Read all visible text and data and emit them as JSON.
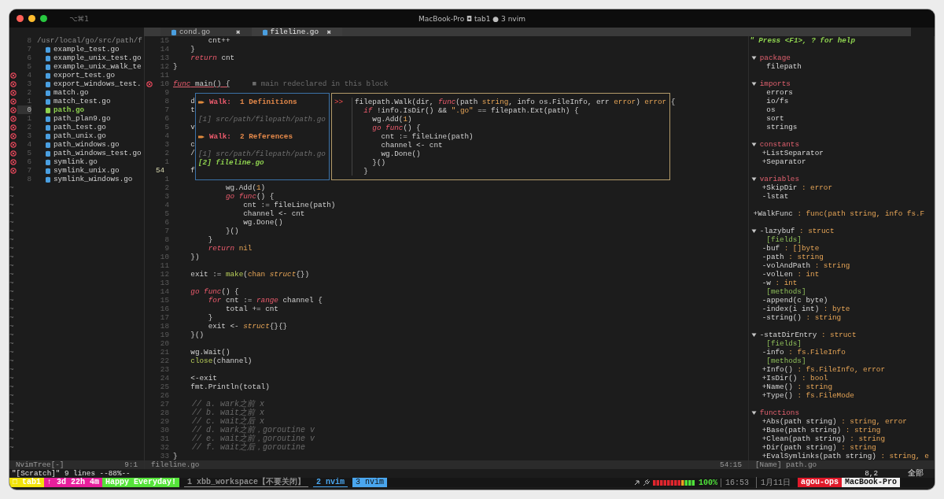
{
  "window": {
    "shortcut": "⌥⌘1",
    "title": "MacBook-Pro ◘ tab1 ● 3 nvim"
  },
  "tabs": [
    {
      "label": "cond.go",
      "close": "✖",
      "selected": false
    },
    {
      "label": "fileline.go",
      "close": "✖",
      "selected": true
    }
  ],
  "tree": {
    "root": {
      "num": "8",
      "path": "/usr/local/go/src/path/f"
    },
    "files": [
      {
        "num": "7",
        "name": "example_test.go",
        "error": false,
        "selected": false
      },
      {
        "num": "6",
        "name": "example_unix_test.go",
        "error": false,
        "selected": false
      },
      {
        "num": "5",
        "name": "example_unix_walk_te",
        "error": false,
        "selected": false
      },
      {
        "num": "4",
        "name": "export_test.go",
        "error": true,
        "selected": false
      },
      {
        "num": "3",
        "name": "export_windows_test.",
        "error": true,
        "selected": false
      },
      {
        "num": "2",
        "name": "match.go",
        "error": true,
        "selected": false
      },
      {
        "num": "1",
        "name": "match_test.go",
        "error": true,
        "selected": false
      },
      {
        "num": "0",
        "name": "path.go",
        "error": true,
        "selected": true
      },
      {
        "num": "1",
        "name": "path_plan9.go",
        "error": true,
        "selected": false
      },
      {
        "num": "2",
        "name": "path_test.go",
        "error": true,
        "selected": false
      },
      {
        "num": "3",
        "name": "path_unix.go",
        "error": true,
        "selected": false
      },
      {
        "num": "4",
        "name": "path_windows.go",
        "error": true,
        "selected": false
      },
      {
        "num": "5",
        "name": "path_windows_test.go",
        "error": true,
        "selected": false
      },
      {
        "num": "6",
        "name": "symlink.go",
        "error": true,
        "selected": false
      },
      {
        "num": "7",
        "name": "symlink_unix.go",
        "error": true,
        "selected": false
      },
      {
        "num": "8",
        "name": "symlink_windows.go",
        "error": false,
        "selected": false
      }
    ],
    "filler": [
      "~",
      "~",
      "~",
      "~",
      "~",
      "~",
      "~",
      "~",
      "~",
      "~",
      "~",
      "~",
      "~",
      "~",
      "~",
      "~",
      "~",
      "~",
      "~",
      "~",
      "~",
      "~",
      "~",
      "~",
      "~",
      "~",
      "~",
      "~",
      "~",
      "~",
      "~"
    ],
    "status": {
      "name": "NvimTree[-]",
      "position": "9:1"
    }
  },
  "editor": {
    "lines": [
      {
        "num": "15",
        "current": false,
        "error": false,
        "tokens": [
          {
            "text": "        cnt++",
            "kind": "plain"
          }
        ]
      },
      {
        "num": "14",
        "current": false,
        "error": false,
        "tokens": [
          {
            "text": "    }",
            "kind": "plain"
          }
        ]
      },
      {
        "num": "13",
        "current": false,
        "error": false,
        "tokens": [
          {
            "text": "    return",
            "kind": "keyword"
          },
          {
            "text": " cnt",
            "kind": "plain"
          }
        ]
      },
      {
        "num": "12",
        "current": false,
        "error": false,
        "tokens": [
          {
            "text": "}",
            "kind": "plain"
          }
        ]
      },
      {
        "num": "11",
        "current": false,
        "error": false
      },
      {
        "num": "10",
        "current": false,
        "error": true,
        "tokens": [
          {
            "text": "func",
            "kind": "errkeyword"
          },
          {
            "text": " main() {",
            "kind": "errplain"
          }
        ],
        "diagnostic": "■ main redeclared in this block"
      },
      {
        "num": "9",
        "current": false,
        "error": false
      },
      {
        "num": "8",
        "current": false,
        "error": false,
        "tokens": [
          {
            "text": "    d",
            "kind": "plain"
          }
        ]
      },
      {
        "num": "7",
        "current": false,
        "error": false,
        "tokens": [
          {
            "text": "    t",
            "kind": "plain"
          }
        ]
      },
      {
        "num": "6",
        "current": false,
        "error": false
      },
      {
        "num": "5",
        "current": false,
        "error": false,
        "tokens": [
          {
            "text": "    v",
            "kind": "plain"
          }
        ]
      },
      {
        "num": "4",
        "current": false,
        "error": false
      },
      {
        "num": "3",
        "current": false,
        "error": false,
        "tokens": [
          {
            "text": "    c",
            "kind": "plain"
          }
        ]
      },
      {
        "num": "2",
        "current": false,
        "error": false,
        "tokens": [
          {
            "text": "    /",
            "kind": "plain"
          }
        ]
      },
      {
        "num": "1",
        "current": false,
        "error": false
      },
      {
        "num": "54",
        "current": true,
        "error": false,
        "tokens": [
          {
            "text": "    f",
            "kind": "plain"
          }
        ]
      },
      {
        "num": "1",
        "current": false,
        "error": false
      },
      {
        "num": "2",
        "current": false,
        "error": false,
        "tokens": [
          {
            "text": "            wg.Add(",
            "kind": "plain"
          },
          {
            "text": "1",
            "kind": "number"
          },
          {
            "text": ")",
            "kind": "plain"
          }
        ]
      },
      {
        "num": "3",
        "current": false,
        "error": false,
        "tokens": [
          {
            "text": "            go func",
            "kind": "keyword"
          },
          {
            "text": "() {",
            "kind": "plain"
          }
        ]
      },
      {
        "num": "4",
        "current": false,
        "error": false,
        "tokens": [
          {
            "text": "                cnt := fileLine(path)",
            "kind": "plain"
          }
        ]
      },
      {
        "num": "5",
        "current": false,
        "error": false,
        "tokens": [
          {
            "text": "                channel <- cnt",
            "kind": "plain"
          }
        ]
      },
      {
        "num": "6",
        "current": false,
        "error": false,
        "tokens": [
          {
            "text": "                wg.Done()",
            "kind": "plain"
          }
        ]
      },
      {
        "num": "7",
        "current": false,
        "error": false,
        "tokens": [
          {
            "text": "            }()",
            "kind": "plain"
          }
        ]
      },
      {
        "num": "8",
        "current": false,
        "error": false,
        "tokens": [
          {
            "text": "        }",
            "kind": "plain"
          }
        ]
      },
      {
        "num": "9",
        "current": false,
        "error": false,
        "tokens": [
          {
            "text": "        return",
            "kind": "keyword"
          },
          {
            "text": " nil",
            "kind": "number"
          }
        ]
      },
      {
        "num": "10",
        "current": false,
        "error": false,
        "tokens": [
          {
            "text": "    })",
            "kind": "plain"
          }
        ]
      },
      {
        "num": "11",
        "current": false,
        "error": false
      },
      {
        "num": "12",
        "current": false,
        "error": false,
        "tokens": [
          {
            "text": "    exit := ",
            "kind": "plain"
          },
          {
            "text": "make",
            "kind": "builtin"
          },
          {
            "text": "(",
            "kind": "plain"
          },
          {
            "text": "chan",
            "kind": "number"
          },
          {
            "text": " struct",
            "kind": "type"
          },
          {
            "text": "{})",
            "kind": "plain"
          }
        ]
      },
      {
        "num": "13",
        "current": false,
        "error": false
      },
      {
        "num": "14",
        "current": false,
        "error": false,
        "tokens": [
          {
            "text": "    go func",
            "kind": "keyword"
          },
          {
            "text": "() {",
            "kind": "plain"
          }
        ]
      },
      {
        "num": "15",
        "current": false,
        "error": false,
        "tokens": [
          {
            "text": "        for",
            "kind": "keyword"
          },
          {
            "text": " cnt := ",
            "kind": "plain"
          },
          {
            "text": "range",
            "kind": "keyword"
          },
          {
            "text": " channel {",
            "kind": "plain"
          }
        ]
      },
      {
        "num": "16",
        "current": false,
        "error": false,
        "tokens": [
          {
            "text": "            total += cnt",
            "kind": "plain"
          }
        ]
      },
      {
        "num": "17",
        "current": false,
        "error": false,
        "tokens": [
          {
            "text": "        }",
            "kind": "plain"
          }
        ]
      },
      {
        "num": "18",
        "current": false,
        "error": false,
        "tokens": [
          {
            "text": "        exit <- ",
            "kind": "plain"
          },
          {
            "text": "struct",
            "kind": "type"
          },
          {
            "text": "{}{}",
            "kind": "plain"
          }
        ]
      },
      {
        "num": "19",
        "current": false,
        "error": false,
        "tokens": [
          {
            "text": "    }()",
            "kind": "plain"
          }
        ]
      },
      {
        "num": "20",
        "current": false,
        "error": false
      },
      {
        "num": "21",
        "current": false,
        "error": false,
        "tokens": [
          {
            "text": "    wg.Wait()",
            "kind": "plain"
          }
        ]
      },
      {
        "num": "22",
        "current": false,
        "error": false,
        "tokens": [
          {
            "text": "    close",
            "kind": "builtin"
          },
          {
            "text": "(channel)",
            "kind": "plain"
          }
        ]
      },
      {
        "num": "23",
        "current": false,
        "error": false
      },
      {
        "num": "24",
        "current": false,
        "error": false,
        "tokens": [
          {
            "text": "    <-exit",
            "kind": "plain"
          }
        ]
      },
      {
        "num": "25",
        "current": false,
        "error": false,
        "tokens": [
          {
            "text": "    fmt.Println(total)",
            "kind": "plain"
          }
        ]
      },
      {
        "num": "26",
        "current": false,
        "error": false
      },
      {
        "num": "27",
        "current": false,
        "error": false,
        "tokens": [
          {
            "text": "    // a. wark之前 x",
            "kind": "comment"
          }
        ]
      },
      {
        "num": "28",
        "current": false,
        "error": false,
        "tokens": [
          {
            "text": "    // b. wait之前 x",
            "kind": "comment"
          }
        ]
      },
      {
        "num": "29",
        "current": false,
        "error": false,
        "tokens": [
          {
            "text": "    // c. wait之后 x",
            "kind": "comment"
          }
        ]
      },
      {
        "num": "30",
        "current": false,
        "error": false,
        "tokens": [
          {
            "text": "    // d. wark之前，goroutine v",
            "kind": "comment"
          }
        ]
      },
      {
        "num": "31",
        "current": false,
        "error": false,
        "tokens": [
          {
            "text": "    // e. wait之前，goroutine v",
            "kind": "comment"
          }
        ]
      },
      {
        "num": "32",
        "current": false,
        "error": false,
        "tokens": [
          {
            "text": "    // f. wait之后，goroutine",
            "kind": "comment"
          }
        ]
      },
      {
        "num": "33",
        "current": false,
        "error": false,
        "tokens": [
          {
            "text": "}",
            "kind": "plain"
          }
        ]
      }
    ],
    "references_popup": {
      "items": [
        {
          "kind": "heading",
          "symbol": "Walk:",
          "title": "1 Definitions"
        },
        {
          "kind": "location",
          "text": "[1] src/path/filepath/path.go",
          "selected": false
        },
        {
          "kind": "heading",
          "symbol": "Walk:",
          "title": "2 References"
        },
        {
          "kind": "location",
          "text": "[1] src/path/filepath/path.go",
          "selected": false
        },
        {
          "kind": "location",
          "text": "[2] fileline.go",
          "selected": true
        }
      ]
    },
    "preview_popup": {
      "marker": ">>",
      "lines": [
        [
          {
            "text": "filepath.Walk(dir, ",
            "kind": "plain"
          },
          {
            "text": "func",
            "kind": "keyword"
          },
          {
            "text": "(path ",
            "kind": "plain"
          },
          {
            "text": "string",
            "kind": "number"
          },
          {
            "text": ", info os.FileInfo, err ",
            "kind": "plain"
          },
          {
            "text": "error",
            "kind": "number"
          },
          {
            "text": ") ",
            "kind": "plain"
          },
          {
            "text": "error",
            "kind": "number"
          },
          {
            "text": " {",
            "kind": "plain"
          }
        ],
        [
          {
            "text": "  if",
            "kind": "keyword"
          },
          {
            "text": " !info.IsDir() && ",
            "kind": "plain"
          },
          {
            "text": "\".go\"",
            "kind": "string"
          },
          {
            "text": " == filepath.Ext(path) {",
            "kind": "plain"
          }
        ],
        [
          {
            "text": "    wg.Add(",
            "kind": "plain"
          },
          {
            "text": "1",
            "kind": "number"
          },
          {
            "text": ")",
            "kind": "plain"
          }
        ],
        [
          {
            "text": "    go func",
            "kind": "keyword"
          },
          {
            "text": "() {",
            "kind": "plain"
          }
        ],
        [
          {
            "text": "      cnt := fileLine(path)",
            "kind": "plain"
          }
        ],
        [
          {
            "text": "      channel <- cnt",
            "kind": "plain"
          }
        ],
        [
          {
            "text": "      wg.Done()",
            "kind": "plain"
          }
        ],
        [
          {
            "text": "    }()",
            "kind": "plain"
          }
        ],
        [
          {
            "text": "  }",
            "kind": "plain"
          }
        ]
      ]
    },
    "status": {
      "name": "fileline.go",
      "position": "54:15"
    }
  },
  "tagbar": {
    "help": "\" Press <F1>, ? for help",
    "items": [
      {
        "kind": "category",
        "label": "package",
        "expanded": true,
        "children": [
          {
            "kind": "plain",
            "name": "filepath"
          }
        ]
      },
      {
        "kind": "category",
        "label": "imports",
        "expanded": true,
        "children": [
          {
            "kind": "plain",
            "name": "errors"
          },
          {
            "kind": "plain",
            "name": "io/fs"
          },
          {
            "kind": "plain",
            "name": "os"
          },
          {
            "kind": "plain",
            "name": "sort"
          },
          {
            "kind": "plain",
            "name": "strings"
          }
        ]
      },
      {
        "kind": "category",
        "label": "constants",
        "expanded": true,
        "children": [
          {
            "kind": "member",
            "name": "+ListSeparator"
          },
          {
            "kind": "member",
            "name": "+Separator"
          }
        ]
      },
      {
        "kind": "category",
        "label": "variables",
        "expanded": true,
        "children": [
          {
            "kind": "member",
            "name": "+SkipDir",
            "type": ": error"
          },
          {
            "kind": "member",
            "name": "-lstat"
          }
        ]
      },
      {
        "kind": "member",
        "name": "+WalkFunc",
        "type": ": func(path string, info fs.F"
      },
      {
        "kind": "typed",
        "label": "-lazybuf",
        "type": ": struct",
        "expanded": true,
        "children": [
          {
            "kind": "group",
            "name": "[fields]"
          },
          {
            "kind": "member",
            "name": "-buf",
            "type": ": []byte"
          },
          {
            "kind": "member",
            "name": "-path",
            "type": ": string"
          },
          {
            "kind": "member",
            "name": "-volAndPath",
            "type": ": string"
          },
          {
            "kind": "member",
            "name": "-volLen",
            "type": ": int"
          },
          {
            "kind": "member",
            "name": "-w",
            "type": ": int"
          },
          {
            "kind": "group",
            "name": "[methods]"
          },
          {
            "kind": "member",
            "name": "-append(c byte)"
          },
          {
            "kind": "member",
            "name": "-index(i int)",
            "type": ": byte"
          },
          {
            "kind": "member",
            "name": "-string()",
            "type": ": string"
          }
        ]
      },
      {
        "kind": "typed",
        "label": "-statDirEntry",
        "type": ": struct",
        "expanded": true,
        "children": [
          {
            "kind": "group",
            "name": "[fields]"
          },
          {
            "kind": "member",
            "name": "-info",
            "type": ": fs.FileInfo"
          },
          {
            "kind": "group",
            "name": "[methods]"
          },
          {
            "kind": "member",
            "name": "+Info()",
            "type": ": fs.FileInfo, error"
          },
          {
            "kind": "member",
            "name": "+IsDir()",
            "type": ": bool"
          },
          {
            "kind": "member",
            "name": "+Name()",
            "type": ": string"
          },
          {
            "kind": "member",
            "name": "+Type()",
            "type": ": fs.FileMode"
          }
        ]
      },
      {
        "kind": "category",
        "label": "functions",
        "expanded": true,
        "children": [
          {
            "kind": "member",
            "name": "+Abs(path string)",
            "type": ": string, error"
          },
          {
            "kind": "member",
            "name": "+Base(path string)",
            "type": ": string"
          },
          {
            "kind": "member",
            "name": "+Clean(path string)",
            "type": ": string"
          },
          {
            "kind": "member",
            "name": "+Dir(path string)",
            "type": ": string"
          },
          {
            "kind": "member",
            "name": "+EvalSymlinks(path string)",
            "type": ": string, e"
          }
        ]
      }
    ],
    "status": {
      "name": "[Name] path.go"
    }
  },
  "command_line": {
    "message": "\"[Scratch]\" 9 lines --88%--",
    "ruler": "8,2",
    "scroll": "全部"
  },
  "tmux": {
    "segments": [
      {
        "text": "□ tab1",
        "color": "#f2e30c"
      },
      {
        "text": "↑ 3d 22h 4m",
        "color": "#e81f9c"
      },
      {
        "text": "Happy Everyday!",
        "color": "#55e33a"
      }
    ],
    "windows": [
      {
        "label": "1 xbb_workspace【不要关闭】",
        "color": "#8c8c8c",
        "selected": false
      },
      {
        "label": "2 nvim",
        "color": "#4aa6ee",
        "selected": false
      },
      {
        "label": "3 nvim",
        "color": "#4aa6ee",
        "selected": true
      }
    ],
    "battery_reading": "100%",
    "time": "16:53",
    "date": "1月11日",
    "badges": [
      {
        "text": "agou-ops",
        "color": "#e0192a"
      },
      {
        "text": "MacBook-Pro",
        "color": "#f0f0f0"
      }
    ]
  }
}
